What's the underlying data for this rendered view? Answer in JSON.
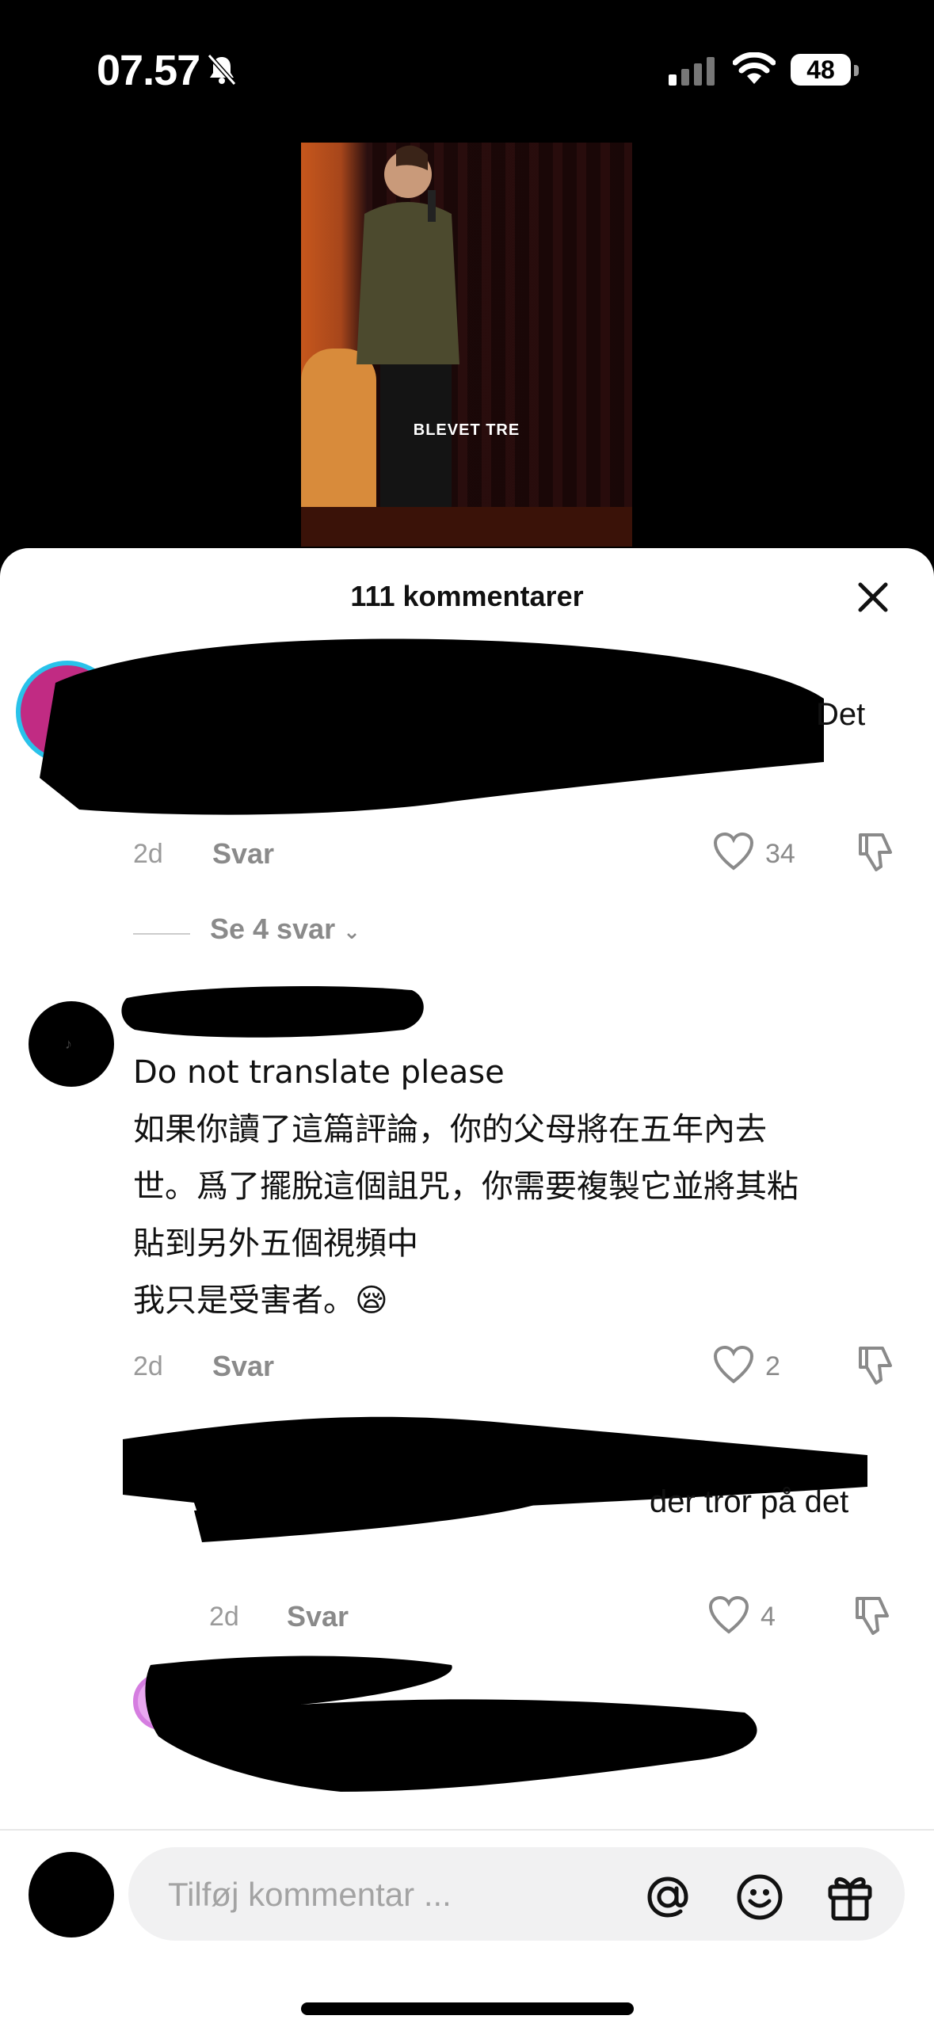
{
  "status_bar": {
    "time": "07.57",
    "battery": "48"
  },
  "video": {
    "caption": "BLEVET TRE"
  },
  "comments_sheet": {
    "title": "111 kommentarer",
    "comments": [
      {
        "text_visible": "Det",
        "age": "2d",
        "reply_label": "Svar",
        "likes": "34",
        "see_replies": "Se 4 svar"
      },
      {
        "lines": [
          "Do not translate please",
          "如果你讀了這篇評論，你的父母將在五年內去",
          "世。爲了擺脫這個詛咒，你需要複製它並將其粘",
          "貼到另外五個視頻中",
          "我只是受害者。😪"
        ],
        "age": "2d",
        "reply_label": "Svar",
        "likes": "2"
      },
      {
        "text_visible": "der tror på det",
        "age": "2d",
        "reply_label": "Svar",
        "likes": "4"
      }
    ]
  },
  "composer": {
    "placeholder": "Tilføj kommentar ..."
  }
}
